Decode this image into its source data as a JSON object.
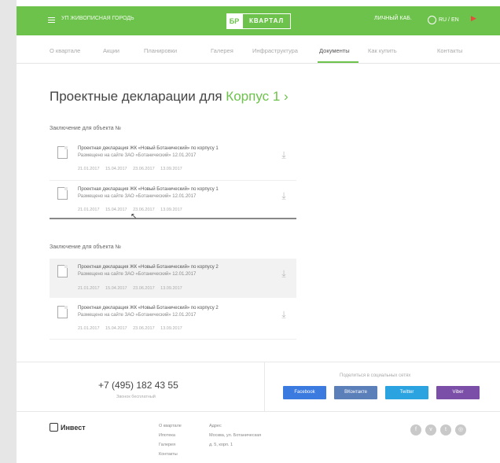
{
  "header": {
    "location": "УП ЖИВОПИСНАЯ ГОРОДЬ",
    "logo_badge": "БР",
    "logo_text": "КВАРТАЛ",
    "user": "ЛИЧНЫЙ КАБ.",
    "lang": "RU / EN",
    "flag": "▶"
  },
  "nav": {
    "items": [
      "О квартале",
      "Акции",
      "Планировки",
      "Галерея",
      "Инфраструктура",
      "Документы",
      "Как купить",
      "Контакты"
    ],
    "active_index": 5
  },
  "page": {
    "title_prefix": "Проектные декларации для ",
    "title_accent": "Корпус 1",
    "title_suffix": " ›"
  },
  "sections": [
    {
      "label": "Заключение для объекта №",
      "docs": [
        {
          "line1": "Проектная декларация ЖК «Новый Ботанический» по корпусу 1",
          "line2": "Размещено на сайте ЗАО «Ботанический» 12.01.2017",
          "meta": "21.01.2017  15.04.2017  23.06.2017  13.09.2017"
        },
        {
          "line1": "Проектная декларация ЖК «Новый Ботанический» по корпусу 1",
          "line2": "Размещено на сайте ЗАО «Ботанический» 12.01.2017",
          "meta": "21.01.2017  15.04.2017  23.06.2017  13.09.2017"
        }
      ]
    },
    {
      "label": "Заключение для объекта №",
      "docs": [
        {
          "line1": "Проектная декларация ЖК «Новый Ботанический» по корпусу 2",
          "line2": "Размещено на сайте ЗАО «Ботанический» 12.01.2017",
          "meta": "21.01.2017  15.04.2017  23.06.2017  13.09.2017"
        },
        {
          "line1": "Проектная декларация ЖК «Новый Ботанический» по корпусу 2",
          "line2": "Размещено на сайте ЗАО «Ботанический» 12.01.2017",
          "meta": "21.01.2017  15.04.2017  23.06.2017  13.09.2017"
        }
      ]
    }
  ],
  "contact": {
    "phone": "+7 (495) 182 43 55",
    "phone_sub": "Звонок бесплатный",
    "share_title": "Поделиться в социальных сетях",
    "share_buttons": [
      {
        "label": "Facebook",
        "color": "#3b7be0"
      },
      {
        "label": "ВКонтакте",
        "color": "#5b7fb8"
      },
      {
        "label": "Twitter",
        "color": "#2aa3e0"
      },
      {
        "label": "Viber",
        "color": "#7b4fa8"
      }
    ]
  },
  "footer": {
    "logo": "Инвест",
    "col1": [
      "О квартале",
      "Ипотека",
      "Галерея",
      "Контакты"
    ],
    "col2_title": "Адрес",
    "col2": [
      "Москва, ул. Ботаническая",
      "д. 5, корп. 1"
    ],
    "social_icons": [
      "facebook-icon",
      "vk-icon",
      "twitter-icon",
      "instagram-icon"
    ]
  },
  "colors": {
    "accent": "#6cc24a",
    "active_doc_bg": "#f2f2f2"
  }
}
